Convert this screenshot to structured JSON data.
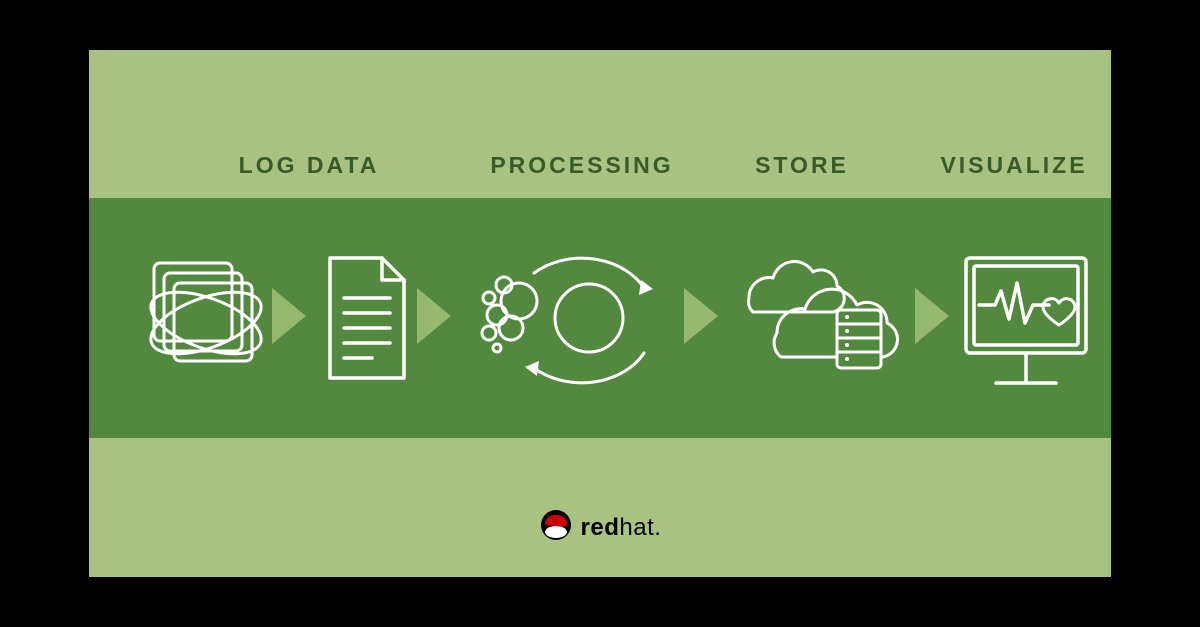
{
  "steps": {
    "logdata": {
      "label": "LOG DATA"
    },
    "processing": {
      "label": "PROCESSING"
    },
    "store": {
      "label": "STORE"
    },
    "visualize": {
      "label": "VISUALIZE"
    }
  },
  "brand": {
    "name_bold": "red",
    "name_rest": "hat.",
    "text": "redhat."
  },
  "colors": {
    "panel": "#a9c181",
    "band": "#53893f",
    "arrow": "#94b86d",
    "label": "#3a5a26",
    "icon_stroke": "#ffffff",
    "brand_red": "#cc0000"
  }
}
